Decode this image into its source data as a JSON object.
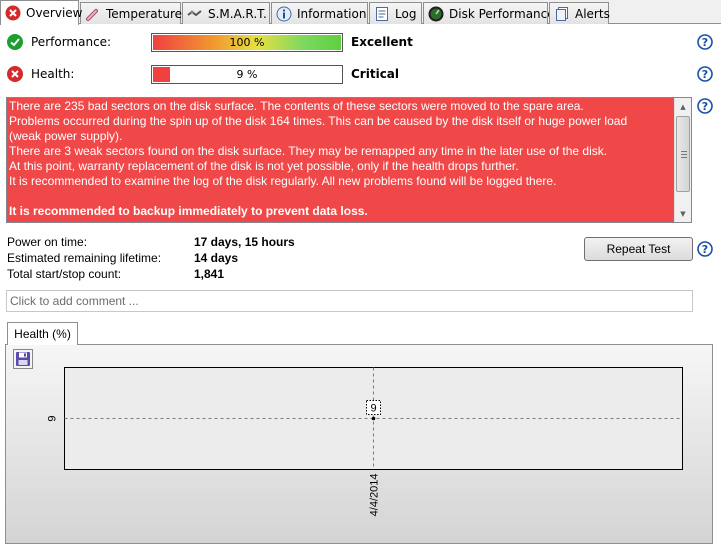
{
  "tabs": [
    {
      "label": "Overview",
      "icon": "red-x-icon"
    },
    {
      "label": "Temperature",
      "icon": "thermometer-icon"
    },
    {
      "label": "S.M.A.R.T.",
      "icon": "smart-chip-icon"
    },
    {
      "label": "Information",
      "icon": "info-icon"
    },
    {
      "label": "Log",
      "icon": "log-document-icon"
    },
    {
      "label": "Disk Performance",
      "icon": "gauge-icon"
    },
    {
      "label": "Alerts",
      "icon": "alerts-document-icon"
    }
  ],
  "performance": {
    "label": "Performance:",
    "value_text": "100 %",
    "level": 1.0,
    "rating": "Excellent"
  },
  "health": {
    "label": "Health:",
    "value_text": "9 %",
    "level": 0.09,
    "rating": "Critical"
  },
  "message": {
    "lines": [
      "There are 235 bad sectors on the disk surface. The contents of these sectors were moved to the spare area.",
      "Problems occurred during the spin up of the disk 164 times. This can be caused by the disk itself or huge power load",
      "(weak power supply).",
      "There are 3 weak sectors found on the disk surface. They may be remapped any time in the later use of the disk.",
      "At this point, warranty replacement of the disk is not yet possible, only if the health drops further.",
      "It is recommended to examine the log of the disk regularly. All new problems found will be logged there."
    ],
    "warning": "It is recommended to backup immediately to prevent data loss."
  },
  "stats": {
    "power_on_label": "Power on time:",
    "power_on_value": "17 days, 15 hours",
    "lifetime_label": "Estimated remaining lifetime:",
    "lifetime_value": "14 days",
    "startstop_label": "Total start/stop count:",
    "startstop_value": "1,841"
  },
  "repeat_test_label": "Repeat Test",
  "comment_placeholder": "Click to add comment ...",
  "chart_tab_label": "Health (%)",
  "colors": {
    "critical_bg": "#f04848",
    "good_icon": "#1e9e2e",
    "bad_icon": "#d62a2a",
    "help_blue": "#1a4fa8"
  },
  "chart_data": {
    "type": "line",
    "x": [
      "4/4/2014"
    ],
    "series": [
      {
        "values": [
          9
        ]
      }
    ],
    "y_ticks": [
      "9"
    ],
    "data_labels": [
      "9"
    ]
  }
}
